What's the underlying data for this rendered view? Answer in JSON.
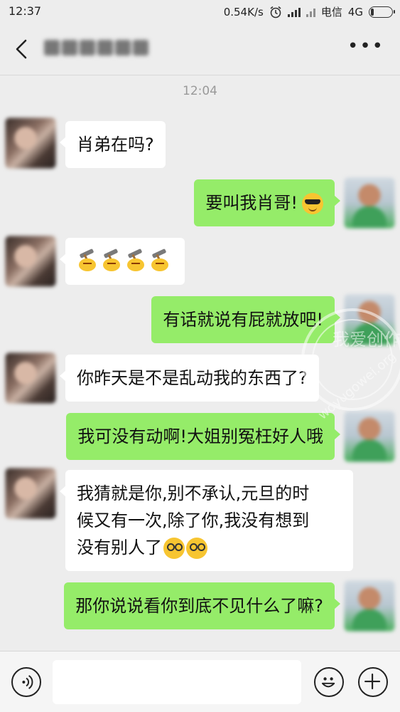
{
  "status_bar": {
    "time": "12:37",
    "network_speed": "0.54K/s",
    "carrier": "电信",
    "network_type": "4G",
    "icons": [
      "alarm-icon",
      "signal-icon",
      "signal-icon",
      "battery-icon"
    ],
    "battery_level": 0.1
  },
  "header": {
    "back_icon": "chevron-left-icon",
    "more_label": "•••"
  },
  "chat": {
    "timestamp": "12:04",
    "messages": [
      {
        "side": "left",
        "text": "肖弟在吗?"
      },
      {
        "side": "right",
        "text": "要叫我肖哥!",
        "emoji": "sunglasses-emoji"
      },
      {
        "side": "left",
        "emoji": "hammer-emoji",
        "emoji_count": 4
      },
      {
        "side": "right",
        "text": "有话就说有屁就放吧!"
      },
      {
        "side": "left",
        "text": "你昨天是不是乱动我的东西了?"
      },
      {
        "side": "right",
        "text": "我可没有动啊!大姐别冤枉好人哦"
      },
      {
        "side": "left",
        "text_lines": [
          "我猜就是你,别不承认,元旦的时",
          "候又有一次,除了你,我没有想到",
          "没有别人了"
        ],
        "emoji": "dizzy-emoji",
        "emoji_count": 2
      },
      {
        "side": "right",
        "text": "那你说说看你到底不见什么了嘛?"
      }
    ]
  },
  "watermark": {
    "text_cn": "我爱创作网",
    "text_en": "woyugowei.org"
  },
  "input_bar": {
    "placeholder": "",
    "voice_icon": "voice-icon",
    "emoji_icon": "smiley-icon",
    "plus_icon": "plus-icon"
  }
}
